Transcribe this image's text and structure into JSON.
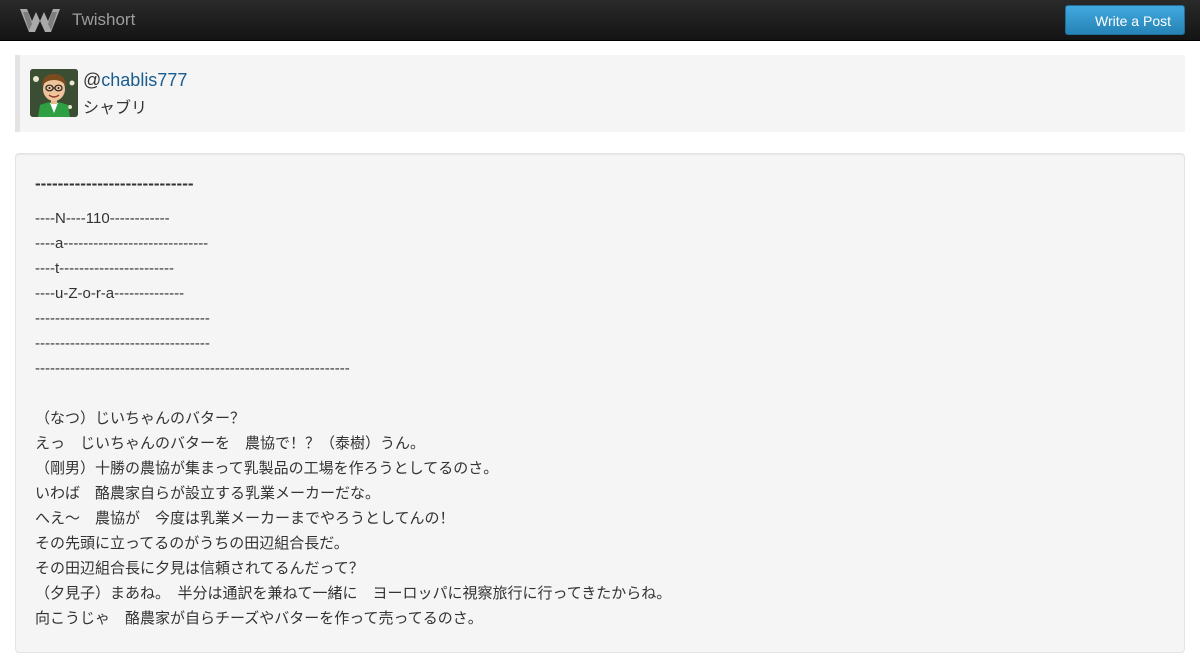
{
  "header": {
    "brand_name": "Twishort",
    "write_button": "Write a Post"
  },
  "profile": {
    "at": "@",
    "handle": "chablis777",
    "display_name": "シャブリ"
  },
  "post": {
    "title": "----------------------------",
    "lines": [
      "----N----110------------",
      "----a-----------------------------",
      "----t-----------------------",
      "----u-Z-o-r-a--------------",
      "-----------------------------------",
      "-----------------------------------",
      "---------------------------------------------------------------",
      "",
      "（なつ）じいちゃんのバター？",
      "えっ　じいちゃんのバターを　農協で！？（泰樹）うん。",
      "（剛男）十勝の農協が集まって乳製品の工場を作ろうとしてるのさ。",
      "いわば　酪農家自らが設立する乳業メーカーだな。",
      "へえ～　農協が　今度は乳業メーカーまでやろうとしてんの！",
      "その先頭に立ってるのがうちの田辺組合長だ。",
      "その田辺組合長に夕見は信頼されてるんだって？",
      "（夕見子）まあね。　半分は通訳を兼ねて一緒に　ヨーロッパに視察旅行に行ってきたからね。",
      "向こうじゃ　酪農家が自らチーズやバターを作って売ってるのさ。"
    ]
  },
  "colors": {
    "navbar": "#1b1b1b",
    "brand_text": "#9d9d9d",
    "button": "#2f93c8",
    "link": "#1a5c8e",
    "well": "#f5f5f5",
    "text": "#333333"
  },
  "icons": {
    "brand": "twishort-bird-logo",
    "avatar": "user-avatar-illustration"
  }
}
